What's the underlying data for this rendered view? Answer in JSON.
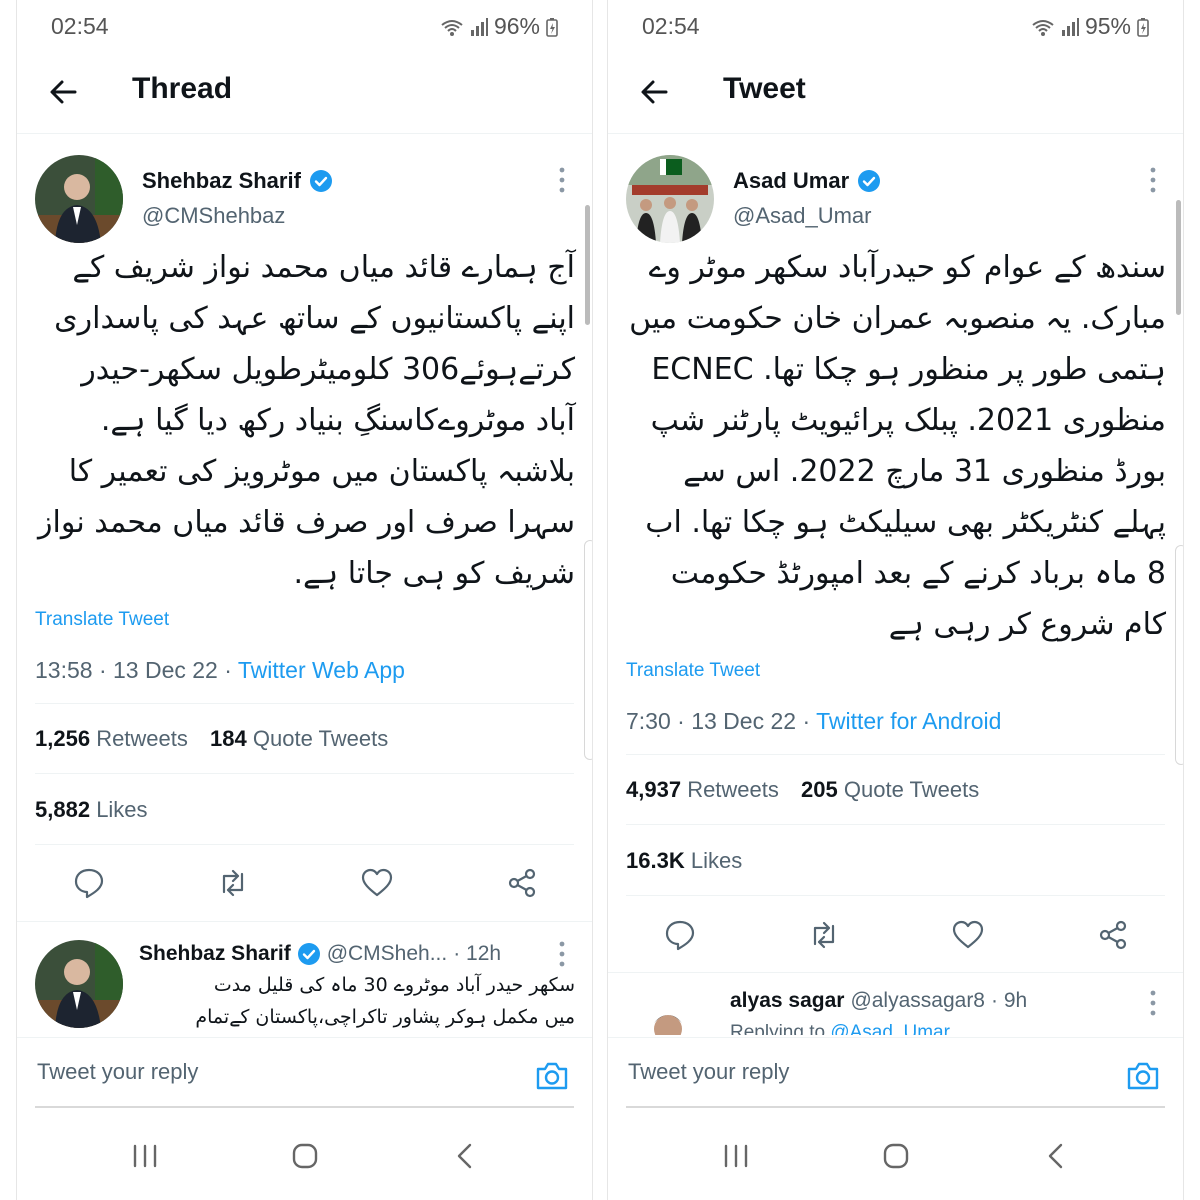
{
  "left": {
    "status": {
      "time": "02:54",
      "battery": "96%"
    },
    "header": {
      "title": "Thread"
    },
    "tweet": {
      "author_name": "Shehbaz Sharif",
      "author_handle": "@CMShehbaz",
      "text_lines": [
        "آج ہمارے قائد میاں محمد نواز شریف کے",
        "اپنے پاکستانیوں کے ساتھ عہد کی پاسداری",
        "کرتےہوئے306 کلومیٹرطویل سکھر-حیدر",
        "آباد موٹروےکاسنگِ بنیاد رکھ دیا گیا ہے.",
        "بلاشبہ پاکستان میں موٹرویز کی تعمیر کا",
        "سہرا صرف اور صرف قائد میاں محمد نواز",
        "شریف کو ہی جاتا ہے."
      ],
      "translate_label": "Translate Tweet",
      "time": "13:58 · 13 Dec 22 · ",
      "source": "Twitter Web App",
      "retweets_count": "1,256",
      "retweets_label": "Retweets",
      "quotes_count": "184",
      "quotes_label": "Quote Tweets",
      "likes_count": "5,882",
      "likes_label": "Likes"
    },
    "reply": {
      "name": "Shehbaz Sharif",
      "handle": "@CMSheh...",
      "age": "· 12h",
      "text_lines": [
        "سکھر حیدر آباد موٹروے 30 ماہ کی قلیل مدت",
        "میں مکمل ہوکر پشاور تاکراچی،پاکستان کےتمام"
      ]
    },
    "reply_bar": {
      "placeholder": "Tweet your reply"
    }
  },
  "right": {
    "status": {
      "time": "02:54",
      "battery": "95%"
    },
    "header": {
      "title": "Tweet"
    },
    "tweet": {
      "author_name": "Asad Umar",
      "author_handle": "@Asad_Umar",
      "text_lines": [
        "سندھ کے عوام کو حیدرآباد سکھر موٹر وے",
        "مبارک. یہ منصوبہ عمران خان حکومت میں",
        "ہتمی طور پر منظور ہو چکا تھا. ECNEC",
        "منظوری 2021. پبلک پرائیویٹ پارٹنر شپ",
        "بورڈ منظوری 31 مارچ 2022. اس سے",
        "پہلے کنٹریکٹر بھی سیلیکٹ ہو چکا تھا. اب",
        "8 ماہ برباد کرنے کے بعد امپورٹڈ حکومت",
        "کام شروع کر رہی ہے"
      ],
      "translate_label": "Translate Tweet",
      "time": "7:30 · 13 Dec 22 · ",
      "source": "Twitter for Android",
      "retweets_count": "4,937",
      "retweets_label": "Retweets",
      "quotes_count": "205",
      "quotes_label": "Quote Tweets",
      "likes_count": "16.3K",
      "likes_label": "Likes"
    },
    "reply": {
      "name": "alyas sagar",
      "handle": "@alyassagar8",
      "age": "· 9h",
      "replying_prefix": "Replying to ",
      "replying_handle": "@Asad_Umar"
    },
    "reply_bar": {
      "placeholder": "Tweet your reply"
    }
  },
  "colors": {
    "accent": "#1d9bf0",
    "text": "#0f1419",
    "muted": "#536471"
  }
}
